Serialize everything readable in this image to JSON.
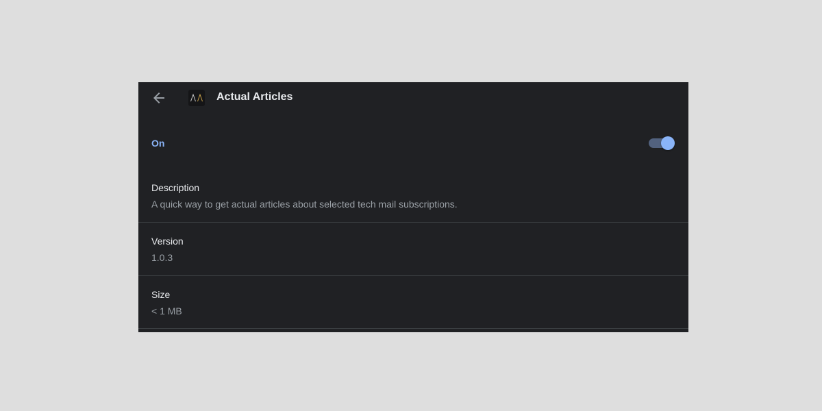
{
  "header": {
    "back_icon": "arrow-left-icon",
    "extension_icon": "actual-articles-logo",
    "title": "Actual Articles"
  },
  "toggle": {
    "label": "On",
    "state": true,
    "accent_color": "#8ab4f8"
  },
  "details": [
    {
      "label": "Description",
      "value": "A quick way to get actual articles about selected tech mail subscriptions."
    },
    {
      "label": "Version",
      "value": "1.0.3"
    },
    {
      "label": "Size",
      "value": "< 1 MB"
    }
  ]
}
